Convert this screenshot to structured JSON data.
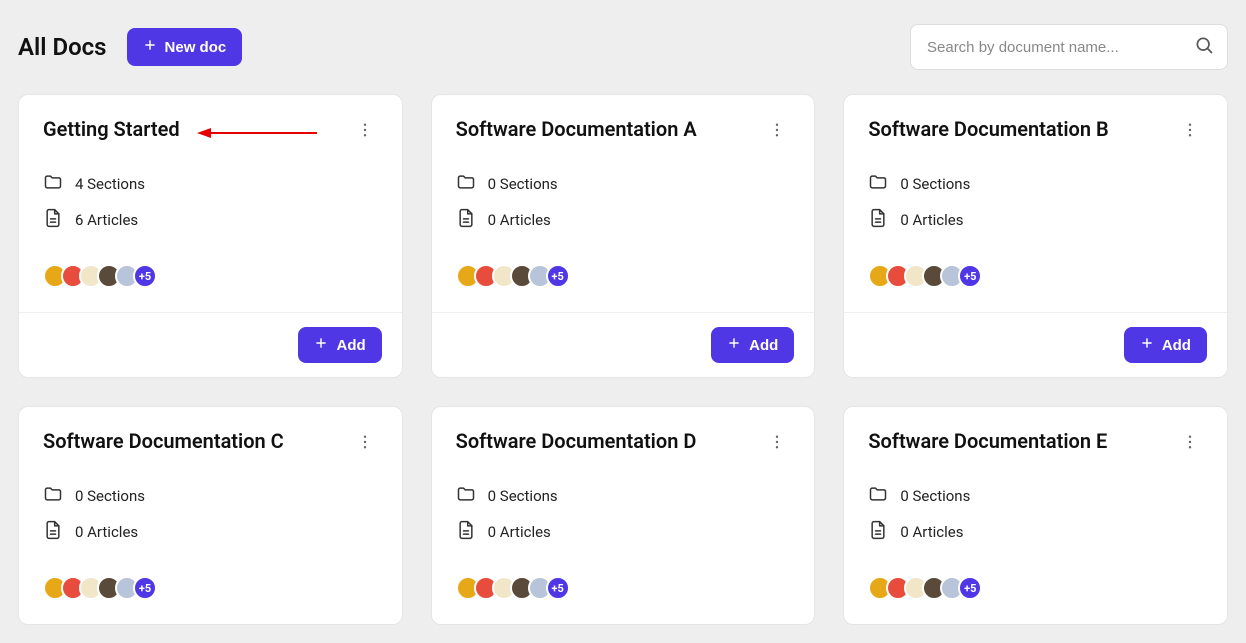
{
  "header": {
    "title": "All Docs",
    "new_doc_label": "New doc",
    "search_placeholder": "Search by document name..."
  },
  "avatar_colors": [
    "#e6a817",
    "#e74c3c",
    "#f1e6c8",
    "#5a4a3a",
    "#b8c4d9"
  ],
  "avatar_more_label": "+5",
  "add_label": "Add",
  "cards": [
    {
      "title": "Getting Started",
      "sections": "4 Sections",
      "articles": "6 Articles",
      "arrow": true,
      "footer": true
    },
    {
      "title": "Software Documentation A",
      "sections": "0 Sections",
      "articles": "0 Articles",
      "arrow": false,
      "footer": true
    },
    {
      "title": "Software Documentation B",
      "sections": "0 Sections",
      "articles": "0 Articles",
      "arrow": false,
      "footer": true
    },
    {
      "title": "Software Documentation C",
      "sections": "0 Sections",
      "articles": "0 Articles",
      "arrow": false,
      "footer": false
    },
    {
      "title": "Software Documentation D",
      "sections": "0 Sections",
      "articles": "0 Articles",
      "arrow": false,
      "footer": false
    },
    {
      "title": "Software Documentation E",
      "sections": "0 Sections",
      "articles": "0 Articles",
      "arrow": false,
      "footer": false
    }
  ]
}
